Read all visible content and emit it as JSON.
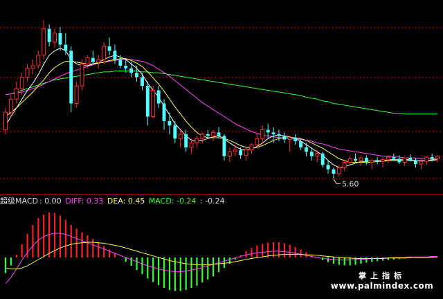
{
  "colors": {
    "up": "#ff3333",
    "down": "#54ffff",
    "ma_white": "#ffffff",
    "ma_yellow": "#ffff44",
    "ma_magenta": "#ff44ff",
    "ma_green": "#33ff33",
    "hist_pos": "#ff2222",
    "hist_neg": "#33ff33",
    "grid_red": "#ff0000",
    "label_white": "#dddddd"
  },
  "legend": {
    "indicator": "超级MACD",
    "indicator_value": ": 0.00",
    "diff_label": "DIFF: 0.33",
    "dea_label": "DEA: 0.45",
    "macd_label": "MACD: -0.24",
    "extra_label": ": -0.24"
  },
  "low_marker": "5.60",
  "watermark": {
    "cn": "掌上指标",
    "url": "www.palmindex.com"
  },
  "chart_data": [
    {
      "type": "candlestick",
      "x": [
        0,
        1,
        2,
        3,
        4,
        5,
        6,
        7,
        8,
        9,
        10,
        11,
        12,
        13,
        14,
        15,
        16,
        17,
        18,
        19,
        20,
        21,
        22,
        23,
        24,
        25,
        26,
        27,
        28,
        29,
        30,
        31,
        32,
        33,
        34,
        35,
        36,
        37,
        38,
        39,
        40,
        41,
        42,
        43,
        44,
        45,
        46,
        47,
        48,
        49,
        50,
        51,
        52,
        53,
        54,
        55,
        56,
        57,
        58,
        59,
        60,
        61,
        62,
        63,
        64,
        65,
        66,
        67,
        68,
        69,
        70,
        71,
        72,
        73,
        74,
        75,
        76,
        77,
        78,
        79
      ],
      "ohlc": [
        [
          6.15,
          6.4,
          6.1,
          6.35
        ],
        [
          6.35,
          6.55,
          6.3,
          6.5
        ],
        [
          6.5,
          6.7,
          6.45,
          6.62
        ],
        [
          6.62,
          6.8,
          6.55,
          6.75
        ],
        [
          6.75,
          6.9,
          6.7,
          6.85
        ],
        [
          6.85,
          6.95,
          6.78,
          6.88
        ],
        [
          6.88,
          7.05,
          6.85,
          7.0
        ],
        [
          7.0,
          7.4,
          6.95,
          7.3
        ],
        [
          7.3,
          7.35,
          7.1,
          7.15
        ],
        [
          7.15,
          7.3,
          7.08,
          7.25
        ],
        [
          7.25,
          7.32,
          7.05,
          7.12
        ],
        [
          7.12,
          7.25,
          7.0,
          7.05
        ],
        [
          7.05,
          7.1,
          6.35,
          6.45
        ],
        [
          6.45,
          6.7,
          6.4,
          6.65
        ],
        [
          6.65,
          6.95,
          6.6,
          6.9
        ],
        [
          6.9,
          7.0,
          6.85,
          6.97
        ],
        [
          6.97,
          7.05,
          6.9,
          6.92
        ],
        [
          6.92,
          7.0,
          6.85,
          6.95
        ],
        [
          6.95,
          7.15,
          6.9,
          7.1
        ],
        [
          7.1,
          7.2,
          7.0,
          7.05
        ],
        [
          7.05,
          7.12,
          6.9,
          6.95
        ],
        [
          6.95,
          7.0,
          6.85,
          6.88
        ],
        [
          6.88,
          6.95,
          6.8,
          6.85
        ],
        [
          6.85,
          6.92,
          6.75,
          6.8
        ],
        [
          6.8,
          6.88,
          6.7,
          6.75
        ],
        [
          6.75,
          6.8,
          6.6,
          6.65
        ],
        [
          6.65,
          6.7,
          6.2,
          6.3
        ],
        [
          6.3,
          6.65,
          6.28,
          6.6
        ],
        [
          6.6,
          6.65,
          6.4,
          6.45
        ],
        [
          6.45,
          6.5,
          6.15,
          6.25
        ],
        [
          6.25,
          6.35,
          6.1,
          6.2
        ],
        [
          6.2,
          6.25,
          6.0,
          6.05
        ],
        [
          6.05,
          6.15,
          5.95,
          6.1
        ],
        [
          6.1,
          6.15,
          5.9,
          5.95
        ],
        [
          5.95,
          6.05,
          5.88,
          6.0
        ],
        [
          6.0,
          6.08,
          5.95,
          6.05
        ],
        [
          6.05,
          6.12,
          6.0,
          6.1
        ],
        [
          6.1,
          6.15,
          6.05,
          6.08
        ],
        [
          6.08,
          6.15,
          6.02,
          6.12
        ],
        [
          6.12,
          6.18,
          6.05,
          6.08
        ],
        [
          6.08,
          6.1,
          5.8,
          5.85
        ],
        [
          5.85,
          5.95,
          5.78,
          5.9
        ],
        [
          5.9,
          5.98,
          5.85,
          5.92
        ],
        [
          5.92,
          5.95,
          5.82,
          5.86
        ],
        [
          5.86,
          5.95,
          5.8,
          5.92
        ],
        [
          5.92,
          6.0,
          5.88,
          5.98
        ],
        [
          5.98,
          6.1,
          5.95,
          6.05
        ],
        [
          6.05,
          6.2,
          6.0,
          6.15
        ],
        [
          6.15,
          6.22,
          6.05,
          6.12
        ],
        [
          6.12,
          6.18,
          6.0,
          6.1
        ],
        [
          6.1,
          6.15,
          6.02,
          6.08
        ],
        [
          6.08,
          6.12,
          6.0,
          6.04
        ],
        [
          6.04,
          6.08,
          5.9,
          6.06
        ],
        [
          6.06,
          6.1,
          5.98,
          6.02
        ],
        [
          6.02,
          6.05,
          5.92,
          5.95
        ],
        [
          5.95,
          6.0,
          5.85,
          5.9
        ],
        [
          5.9,
          5.95,
          5.8,
          5.85
        ],
        [
          5.85,
          5.92,
          5.78,
          5.88
        ],
        [
          5.88,
          5.9,
          5.72,
          5.75
        ],
        [
          5.75,
          5.8,
          5.65,
          5.7
        ],
        [
          5.7,
          5.72,
          5.6,
          5.65
        ],
        [
          5.65,
          5.75,
          5.62,
          5.72
        ],
        [
          5.72,
          5.8,
          5.68,
          5.78
        ],
        [
          5.78,
          5.85,
          5.75,
          5.82
        ],
        [
          5.82,
          5.88,
          5.78,
          5.8
        ],
        [
          5.8,
          5.85,
          5.74,
          5.83
        ],
        [
          5.83,
          5.86,
          5.75,
          5.78
        ],
        [
          5.78,
          5.82,
          5.7,
          5.8
        ],
        [
          5.8,
          5.84,
          5.76,
          5.79
        ],
        [
          5.79,
          5.83,
          5.72,
          5.81
        ],
        [
          5.81,
          5.86,
          5.77,
          5.84
        ],
        [
          5.84,
          5.88,
          5.8,
          5.82
        ],
        [
          5.82,
          5.86,
          5.76,
          5.78
        ],
        [
          5.78,
          5.84,
          5.74,
          5.83
        ],
        [
          5.83,
          5.87,
          5.79,
          5.8
        ],
        [
          5.8,
          5.83,
          5.72,
          5.76
        ],
        [
          5.76,
          5.82,
          5.7,
          5.79
        ],
        [
          5.79,
          5.85,
          5.75,
          5.84
        ],
        [
          5.84,
          5.88,
          5.79,
          5.82
        ],
        [
          5.82,
          5.86,
          5.78,
          5.85
        ]
      ],
      "ma": {
        "white": [
          6.2,
          6.3,
          6.4,
          6.5,
          6.6,
          6.68,
          6.78,
          6.9,
          7.0,
          7.05,
          7.08,
          7.05,
          6.95,
          6.9,
          6.88,
          6.88,
          6.9,
          6.92,
          6.95,
          6.98,
          7.0,
          6.98,
          6.95,
          6.9,
          6.85,
          6.78,
          6.68,
          6.6,
          6.52,
          6.42,
          6.32,
          6.22,
          6.15,
          6.08,
          6.03,
          6.02,
          6.03,
          6.05,
          6.07,
          6.08,
          6.05,
          6.0,
          5.96,
          5.93,
          5.92,
          5.93,
          5.96,
          6.0,
          6.05,
          6.08,
          6.09,
          6.08,
          6.07,
          6.05,
          6.02,
          5.98,
          5.94,
          5.9,
          5.86,
          5.8,
          5.75,
          5.72,
          5.73,
          5.75,
          5.77,
          5.79,
          5.79,
          5.8,
          5.8,
          5.8,
          5.81,
          5.81,
          5.81,
          5.81,
          5.81,
          5.8,
          5.8,
          5.8,
          5.81,
          5.82
        ],
        "yellow": [
          6.3,
          6.35,
          6.4,
          6.46,
          6.52,
          6.58,
          6.65,
          6.72,
          6.8,
          6.86,
          6.9,
          6.93,
          6.93,
          6.92,
          6.91,
          6.9,
          6.9,
          6.91,
          6.92,
          6.94,
          6.95,
          6.96,
          6.96,
          6.94,
          6.91,
          6.87,
          6.81,
          6.74,
          6.67,
          6.59,
          6.5,
          6.41,
          6.33,
          6.25,
          6.18,
          6.12,
          6.08,
          6.06,
          6.06,
          6.06,
          6.05,
          6.03,
          6.0,
          5.97,
          5.95,
          5.94,
          5.95,
          5.97,
          6.0,
          6.03,
          6.05,
          6.06,
          6.06,
          6.06,
          6.05,
          6.03,
          6.0,
          5.97,
          5.94,
          5.9,
          5.86,
          5.82,
          5.8,
          5.78,
          5.78,
          5.78,
          5.78,
          5.78,
          5.79,
          5.79,
          5.8,
          5.8,
          5.8,
          5.8,
          5.8,
          5.8,
          5.8,
          5.8,
          5.8,
          5.81
        ],
        "magenta": [
          6.55,
          6.56,
          6.57,
          6.58,
          6.6,
          6.62,
          6.64,
          6.67,
          6.7,
          6.73,
          6.76,
          6.79,
          6.81,
          6.83,
          6.85,
          6.87,
          6.89,
          6.91,
          6.92,
          6.93,
          6.94,
          6.95,
          6.95,
          6.95,
          6.94,
          6.93,
          6.91,
          6.88,
          6.84,
          6.8,
          6.76,
          6.71,
          6.66,
          6.61,
          6.56,
          6.51,
          6.46,
          6.42,
          6.38,
          6.34,
          6.3,
          6.26,
          6.22,
          6.19,
          6.16,
          6.13,
          6.11,
          6.09,
          6.08,
          6.07,
          6.06,
          6.06,
          6.05,
          6.05,
          6.04,
          6.03,
          6.02,
          6.0,
          5.99,
          5.97,
          5.95,
          5.93,
          5.92,
          5.91,
          5.9,
          5.89,
          5.88,
          5.87,
          5.86,
          5.85,
          5.85,
          5.84,
          5.84,
          5.83,
          5.83,
          5.83,
          5.82,
          5.82,
          5.82,
          5.82
        ],
        "green": [
          6.55,
          6.56,
          6.58,
          6.6,
          6.62,
          6.64,
          6.66,
          6.68,
          6.7,
          6.72,
          6.73,
          6.74,
          6.75,
          6.76,
          6.77,
          6.78,
          6.79,
          6.8,
          6.81,
          6.81,
          6.82,
          6.82,
          6.82,
          6.82,
          6.82,
          6.81,
          6.81,
          6.8,
          6.8,
          6.79,
          6.78,
          6.77,
          6.76,
          6.75,
          6.74,
          6.73,
          6.72,
          6.71,
          6.7,
          6.69,
          6.68,
          6.67,
          6.66,
          6.65,
          6.64,
          6.63,
          6.62,
          6.61,
          6.6,
          6.59,
          6.58,
          6.57,
          6.56,
          6.55,
          6.54,
          6.52,
          6.51,
          6.5,
          6.48,
          6.47,
          6.45,
          6.44,
          6.43,
          6.42,
          6.41,
          6.4,
          6.39,
          6.38,
          6.37,
          6.36,
          6.35,
          6.34,
          6.34,
          6.33,
          6.33,
          6.33,
          6.33,
          6.33,
          6.33,
          6.33
        ]
      },
      "ylim": [
        5.5,
        7.55
      ]
    },
    {
      "type": "bar",
      "x": [
        0,
        1,
        2,
        3,
        4,
        5,
        6,
        7,
        8,
        9,
        10,
        11,
        12,
        13,
        14,
        15,
        16,
        17,
        18,
        19,
        20,
        21,
        22,
        23,
        24,
        25,
        26,
        27,
        28,
        29,
        30,
        31,
        32,
        33,
        34,
        35,
        36,
        37,
        38,
        39,
        40,
        41,
        42,
        43,
        44,
        45,
        46,
        47,
        48,
        49,
        50,
        51,
        52,
        53,
        54,
        55,
        56,
        57,
        58,
        59,
        60,
        61,
        62,
        63,
        64,
        65,
        66,
        67,
        68,
        69,
        70,
        71,
        72,
        73,
        74,
        75,
        76,
        77,
        78,
        79
      ],
      "macd": [
        -0.3,
        -0.15,
        0.05,
        0.25,
        0.45,
        0.62,
        0.75,
        0.82,
        0.86,
        0.85,
        0.8,
        0.72,
        0.62,
        0.55,
        0.48,
        0.42,
        0.35,
        0.28,
        0.22,
        0.15,
        0.08,
        0.0,
        -0.08,
        -0.16,
        -0.24,
        -0.32,
        -0.4,
        -0.47,
        -0.53,
        -0.58,
        -0.62,
        -0.64,
        -0.64,
        -0.62,
        -0.58,
        -0.54,
        -0.48,
        -0.42,
        -0.36,
        -0.28,
        -0.2,
        -0.12,
        -0.04,
        0.04,
        0.12,
        0.18,
        0.23,
        0.26,
        0.28,
        0.29,
        0.29,
        0.27,
        0.24,
        0.2,
        0.15,
        0.1,
        0.05,
        0.0,
        -0.05,
        -0.09,
        -0.12,
        -0.14,
        -0.15,
        -0.15,
        -0.14,
        -0.12,
        -0.1,
        -0.08,
        -0.07,
        -0.06,
        -0.05,
        -0.04,
        -0.03,
        -0.02,
        -0.01,
        0.0,
        0.0,
        0.01,
        0.01,
        0.0
      ],
      "diff": [
        -0.5,
        -0.38,
        -0.22,
        -0.05,
        0.1,
        0.22,
        0.33,
        0.4,
        0.44,
        0.46,
        0.46,
        0.44,
        0.4,
        0.36,
        0.32,
        0.28,
        0.24,
        0.2,
        0.16,
        0.12,
        0.08,
        0.04,
        0.0,
        -0.04,
        -0.08,
        -0.12,
        -0.16,
        -0.19,
        -0.22,
        -0.24,
        -0.26,
        -0.27,
        -0.27,
        -0.26,
        -0.24,
        -0.22,
        -0.19,
        -0.16,
        -0.13,
        -0.1,
        -0.07,
        -0.04,
        -0.01,
        0.02,
        0.05,
        0.07,
        0.09,
        0.1,
        0.11,
        0.12,
        0.12,
        0.11,
        0.1,
        0.08,
        0.06,
        0.04,
        0.02,
        0.0,
        -0.02,
        -0.03,
        -0.04,
        -0.05,
        -0.05,
        -0.05,
        -0.04,
        -0.04,
        -0.03,
        -0.02,
        -0.02,
        -0.01,
        -0.01,
        0.0,
        0.0,
        0.0,
        0.01,
        0.01,
        0.01,
        0.01,
        0.02,
        0.02
      ],
      "dea": [
        -0.2,
        -0.22,
        -0.22,
        -0.2,
        -0.16,
        -0.1,
        -0.04,
        0.02,
        0.08,
        0.13,
        0.18,
        0.22,
        0.25,
        0.27,
        0.28,
        0.29,
        0.29,
        0.28,
        0.27,
        0.25,
        0.23,
        0.21,
        0.18,
        0.15,
        0.12,
        0.09,
        0.06,
        0.03,
        0.0,
        -0.03,
        -0.06,
        -0.08,
        -0.1,
        -0.12,
        -0.13,
        -0.14,
        -0.14,
        -0.14,
        -0.13,
        -0.12,
        -0.11,
        -0.1,
        -0.08,
        -0.06,
        -0.04,
        -0.02,
        0.0,
        0.01,
        0.03,
        0.04,
        0.05,
        0.06,
        0.06,
        0.06,
        0.06,
        0.05,
        0.05,
        0.04,
        0.03,
        0.02,
        0.01,
        0.0,
        -0.01,
        -0.01,
        -0.02,
        -0.02,
        -0.02,
        -0.02,
        -0.02,
        -0.02,
        -0.01,
        -0.01,
        -0.01,
        -0.01,
        0.0,
        0.0,
        0.0,
        0.0,
        0.0,
        0.01
      ],
      "ylim": [
        -0.7,
        0.95
      ]
    }
  ]
}
